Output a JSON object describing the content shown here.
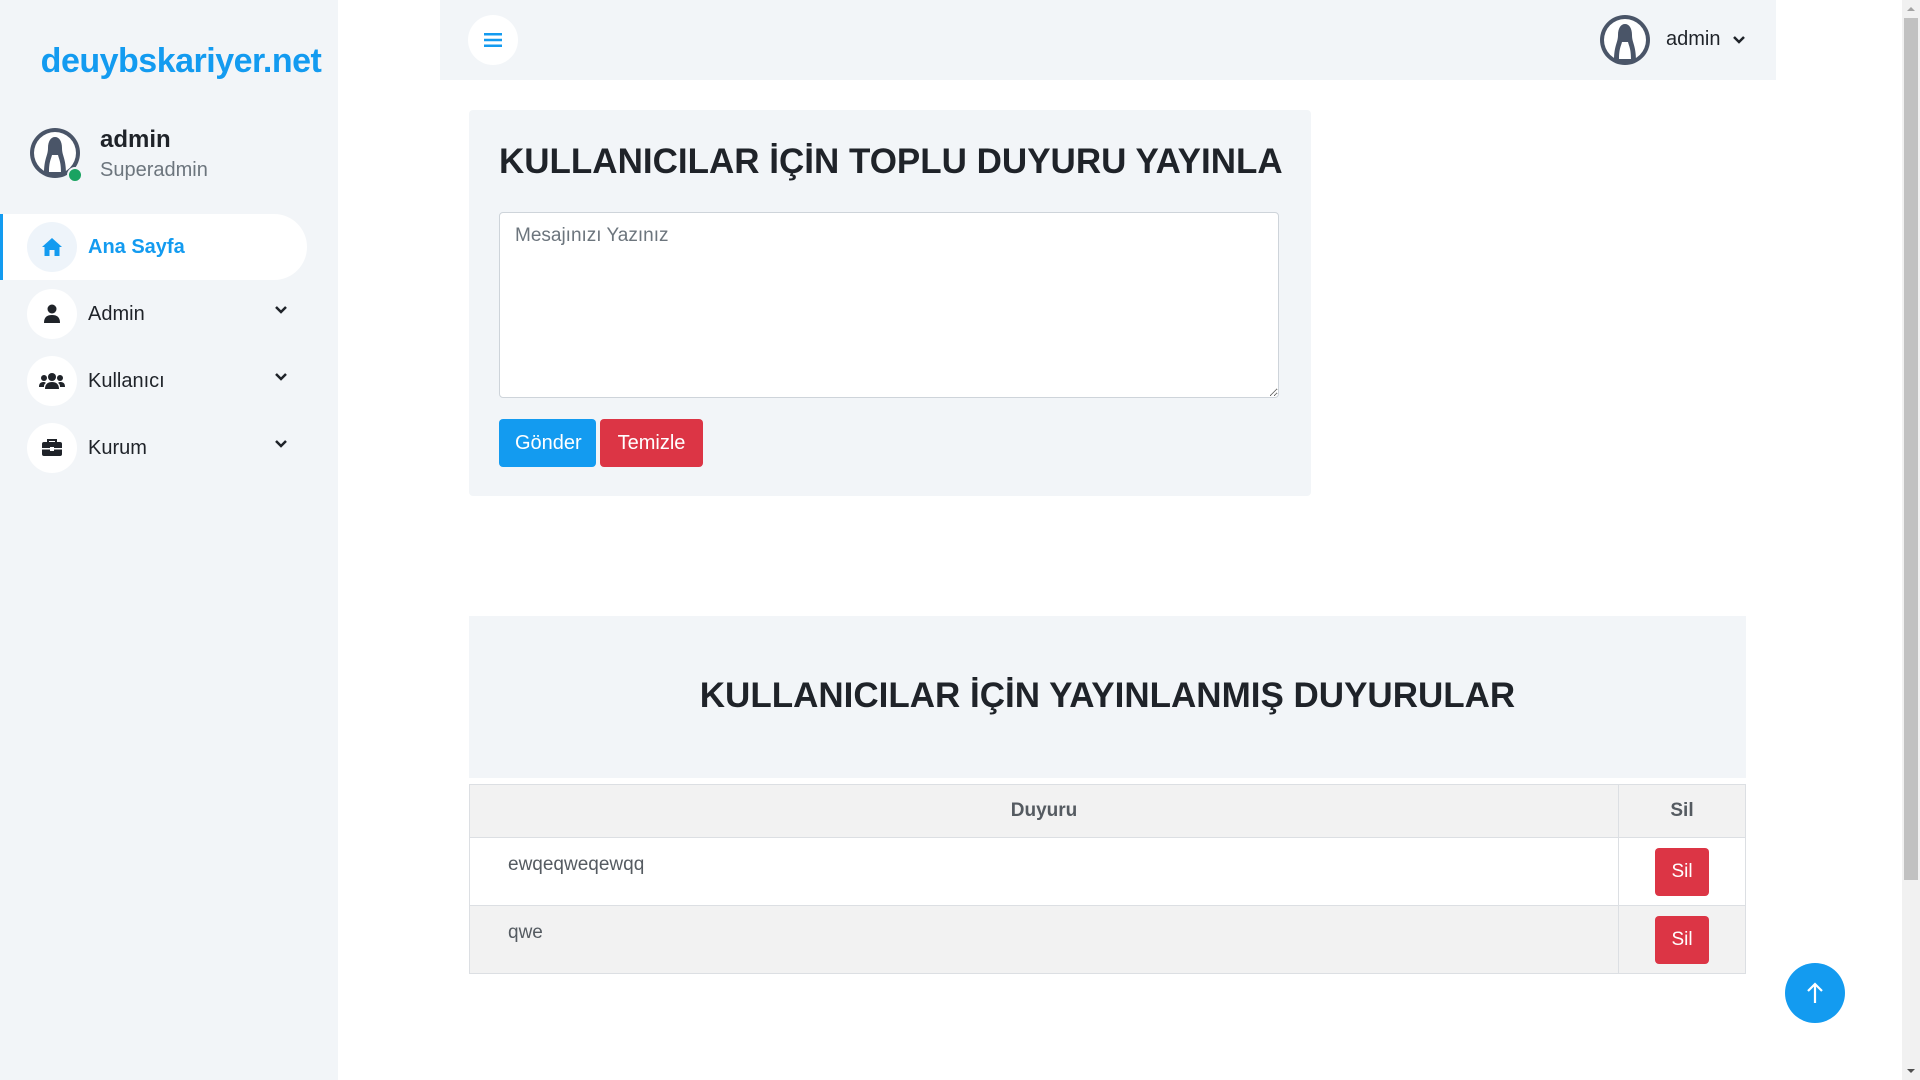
{
  "sidebar": {
    "brand": "deuybskariyer.net",
    "profile": {
      "name": "admin",
      "role": "Superadmin"
    },
    "items": [
      {
        "label": "Ana Sayfa",
        "icon": "home-icon",
        "active": true
      },
      {
        "label": "Admin",
        "icon": "user-icon"
      },
      {
        "label": "Kullanıcı",
        "icon": "users-icon"
      },
      {
        "label": "Kurum",
        "icon": "briefcase-icon"
      }
    ]
  },
  "topbar": {
    "user_name": "admin"
  },
  "announce_form": {
    "title": "KULLANICILAR İÇİN TOPLU DUYURU YAYINLA",
    "placeholder": "Mesajınızı Yazınız",
    "send_label": "Gönder",
    "clear_label": "Temizle"
  },
  "published": {
    "title": "KULLANICILAR İÇİN YAYINLANMIŞ DUYURULAR",
    "columns": [
      "Duyuru",
      "Sil"
    ],
    "rows": [
      {
        "text": "ewqeqweqewqq",
        "delete_label": "Sil"
      },
      {
        "text": "qwe",
        "delete_label": "Sil"
      }
    ]
  },
  "colors": {
    "accent": "#139bf0",
    "danger": "#dc3545",
    "panel": "#f2f5f8",
    "online": "#1aa361"
  }
}
